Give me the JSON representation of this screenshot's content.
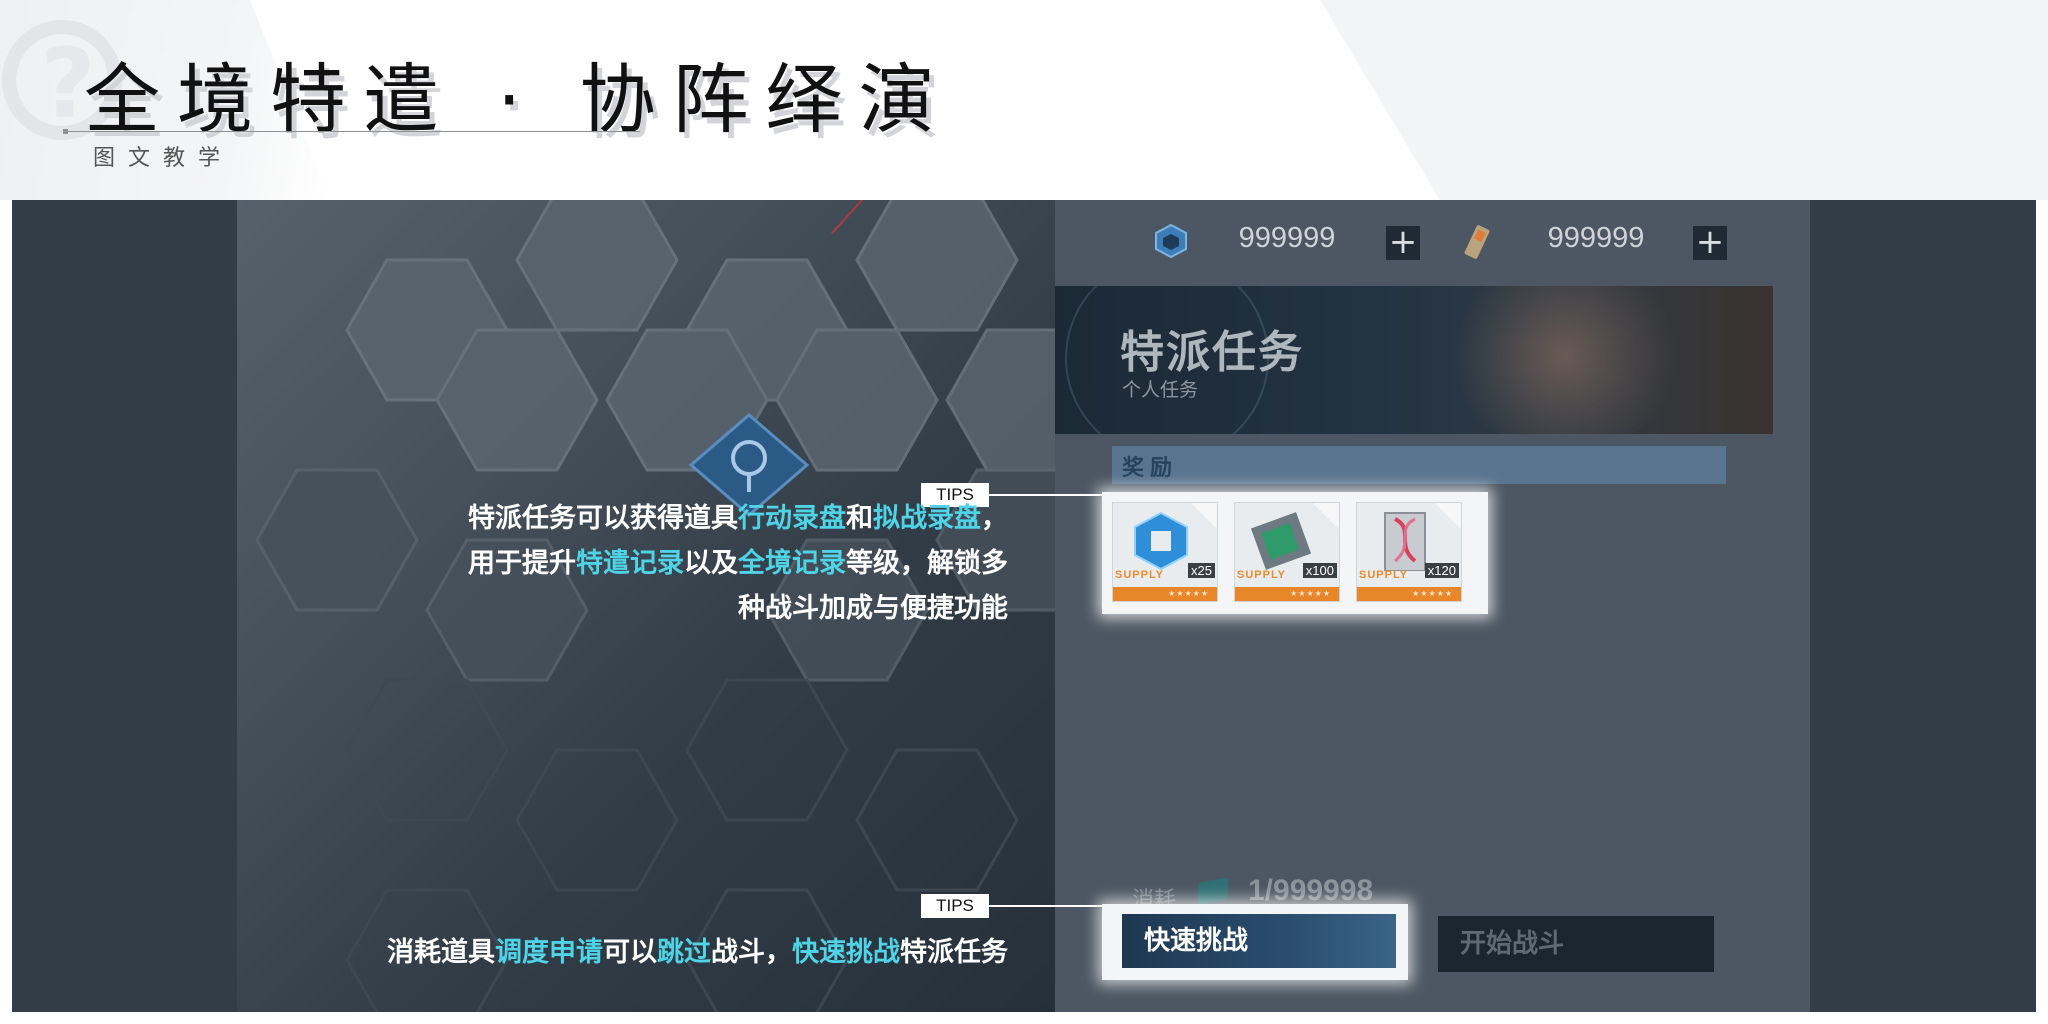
{
  "header": {
    "title": "全境特遣 · 协阵绎演",
    "subtitle": "图文教学"
  },
  "resources": [
    {
      "icon": "cube-currency-icon",
      "value": "999999",
      "plus": "+"
    },
    {
      "icon": "battery-item-icon",
      "value": "999999",
      "plus": "+"
    }
  ],
  "mission": {
    "title": "特派任务",
    "subtitle": "个人任务",
    "rewards_label": "奖励",
    "rewards": [
      {
        "name": "cube-blueprint",
        "supply": "SUPPLY",
        "qty": "x25"
      },
      {
        "name": "circuit-board",
        "supply": "SUPPLY",
        "qty": "x100"
      },
      {
        "name": "dna-module",
        "supply": "SUPPLY",
        "qty": "x120"
      }
    ],
    "cost_label": "消耗",
    "cost_value": "1/999998",
    "quick_button": "快速挑战",
    "start_button": "开始战斗"
  },
  "tips": {
    "tag": "TIPS",
    "tip1": {
      "line1": {
        "t1": "特派任务可以获得道具",
        "h1": "行动录盘",
        "t2": "和",
        "h2": "拟战录盘",
        "t3": "，"
      },
      "line2": {
        "t1": "用于提升",
        "h1": "特遣记录",
        "t2": "以及",
        "h2": "全境记录",
        "t3": "等级，解锁多"
      },
      "line3": "种战斗加成与便捷功能"
    },
    "tip2": {
      "t1": "消耗道具",
      "h1": "调度申请",
      "t2": "可以",
      "h2": "跳过",
      "t3": "战斗，",
      "h3": "快速挑战",
      "t4": "特派任务"
    }
  },
  "colors": {
    "highlight": "#4fd3e6",
    "button_blue": "#2a4d6e",
    "reward_orange": "#e8862a"
  }
}
